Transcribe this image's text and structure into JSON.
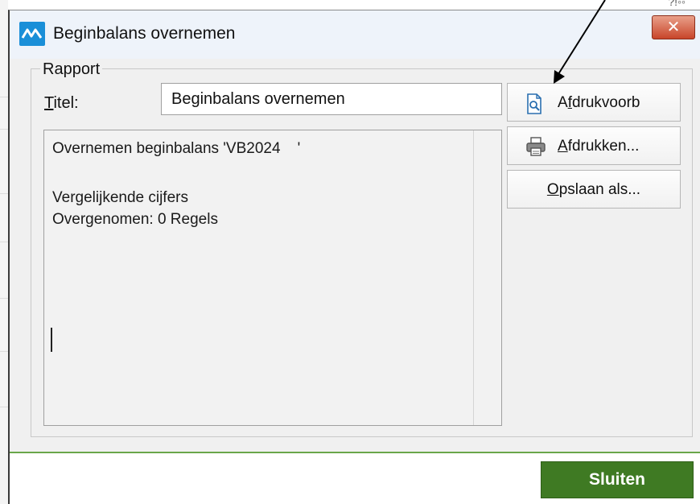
{
  "window": {
    "title": "Beginbalans overnemen",
    "close_label": "✕"
  },
  "background": {
    "corner_text": "?!◦◦"
  },
  "report_group": {
    "label": "Rapport",
    "titel_label_accel": "T",
    "titel_label_rest": "itel:",
    "titel_value": "Beginbalans overnemen",
    "lines": [
      "Overnemen beginbalans 'VB2024    '",
      "",
      "Vergelijkende cijfers",
      "Overgenomen: 0 Regels"
    ]
  },
  "buttons": {
    "preview": {
      "pre": "A",
      "accel": "f",
      "post": "drukvoorb",
      "icon": "print-preview-icon"
    },
    "print": {
      "pre": "",
      "accel": "A",
      "post": "fdrukken...",
      "icon": "printer-icon"
    },
    "save_as": {
      "pre": "",
      "accel": "O",
      "post": "pslaan als..."
    },
    "close": {
      "label": "Sluiten"
    }
  },
  "colors": {
    "accent_green": "#3f7a23",
    "app_icon_blue": "#1a8fd8",
    "close_red": "#c8452a"
  }
}
